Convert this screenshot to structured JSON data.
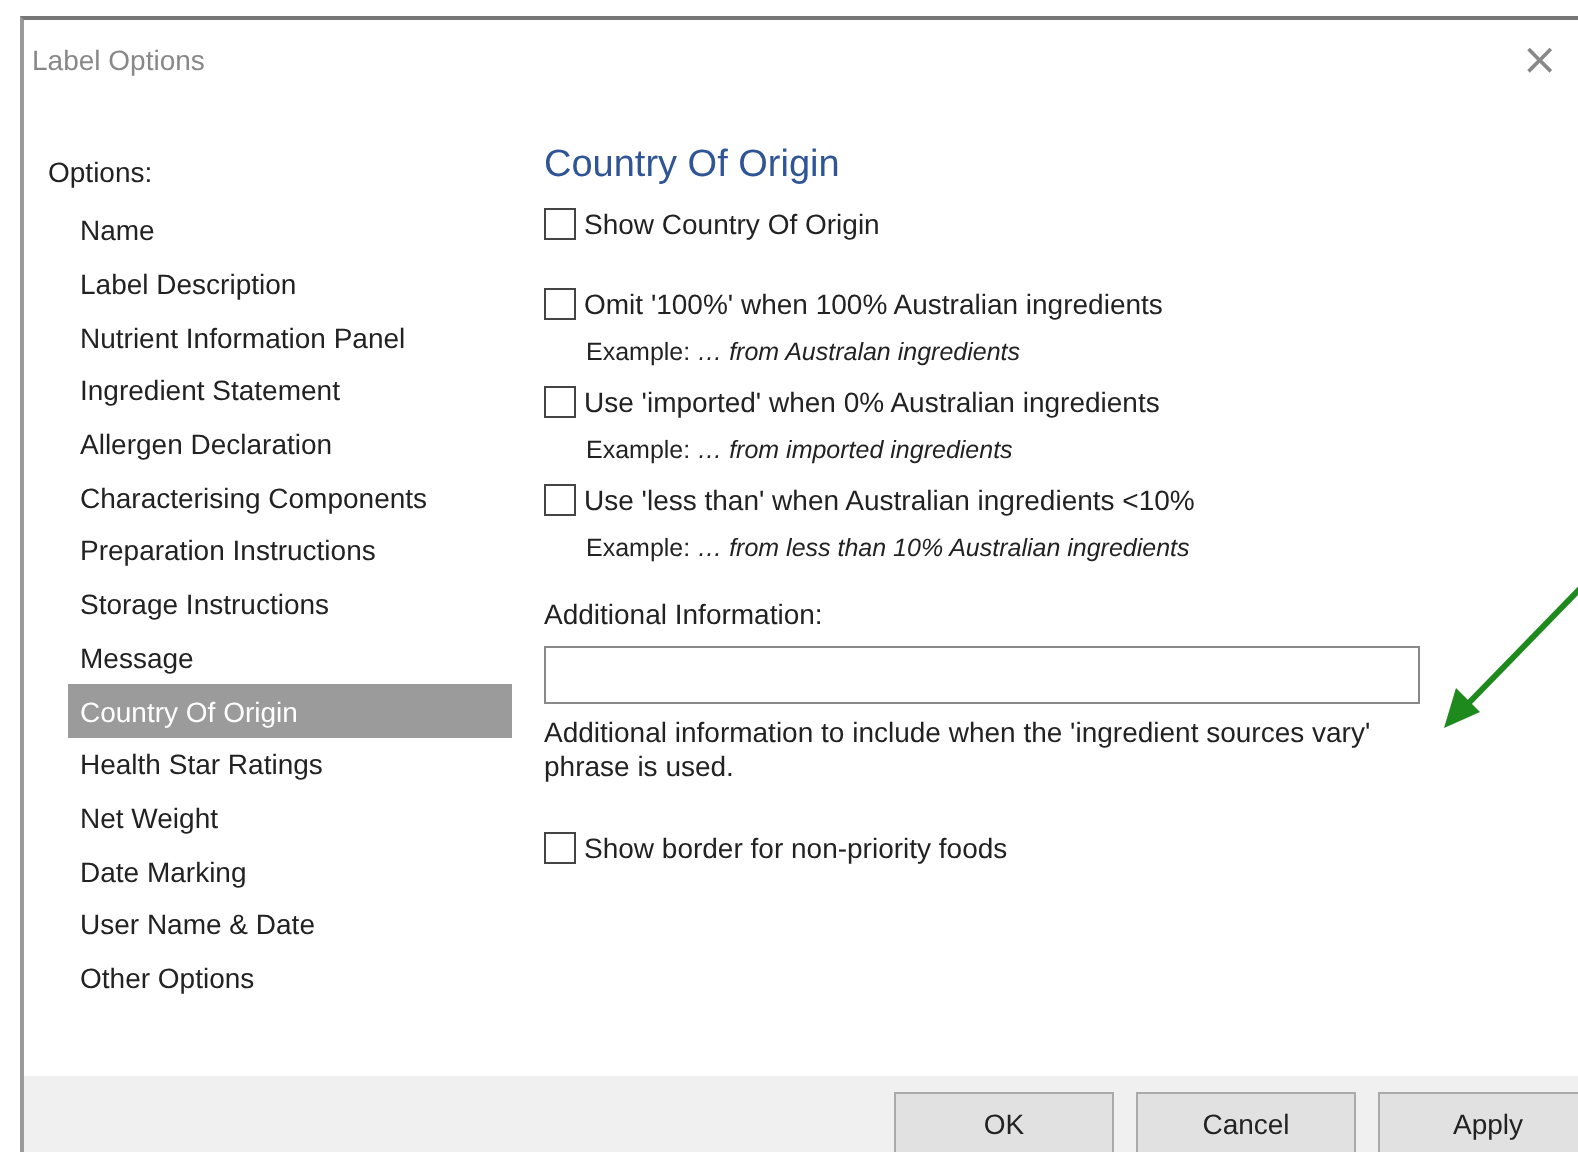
{
  "window": {
    "title": "Label Options",
    "close": "×"
  },
  "sidebar": {
    "heading": "Options:",
    "items": [
      {
        "label": "Name",
        "selected": false
      },
      {
        "label": "Label Description",
        "selected": false
      },
      {
        "label": "Nutrient Information Panel",
        "selected": false
      },
      {
        "label": "Ingredient Statement",
        "selected": false
      },
      {
        "label": "Allergen Declaration",
        "selected": false
      },
      {
        "label": "Characterising Components",
        "selected": false
      },
      {
        "label": "Preparation Instructions",
        "selected": false
      },
      {
        "label": "Storage Instructions",
        "selected": false
      },
      {
        "label": "Message",
        "selected": false
      },
      {
        "label": "Country Of Origin",
        "selected": true
      },
      {
        "label": "Health Star Ratings",
        "selected": false
      },
      {
        "label": "Net Weight",
        "selected": false
      },
      {
        "label": "Date Marking",
        "selected": false
      },
      {
        "label": "User Name & Date",
        "selected": false
      },
      {
        "label": "Other Options",
        "selected": false
      }
    ]
  },
  "panel": {
    "heading": "Country Of Origin",
    "show_option": {
      "label": "Show Country Of Origin",
      "checked": false
    },
    "options": [
      {
        "label": "Omit '100%' when 100% Australian ingredients",
        "checked": false,
        "example": "Example:  *… from Australan ingredients*"
      },
      {
        "label": "Use 'imported' when 0% Australian ingredients",
        "checked": false,
        "example": "Example:  *… from imported ingredients*"
      },
      {
        "label": "Use 'less than' when Australian ingredients <10%",
        "checked": false,
        "example": "Example:  *… from less than 10% Australian ingredients*"
      }
    ],
    "additional_label": "Additional Information:",
    "additional_help": "Additional information to include when the 'ingredient sources vary' phrase is used.",
    "border_option": {
      "label": "Show border for non-priority foods",
      "checked": false
    }
  },
  "buttons": [
    "OK",
    "Cancel",
    "Apply"
  ]
}
